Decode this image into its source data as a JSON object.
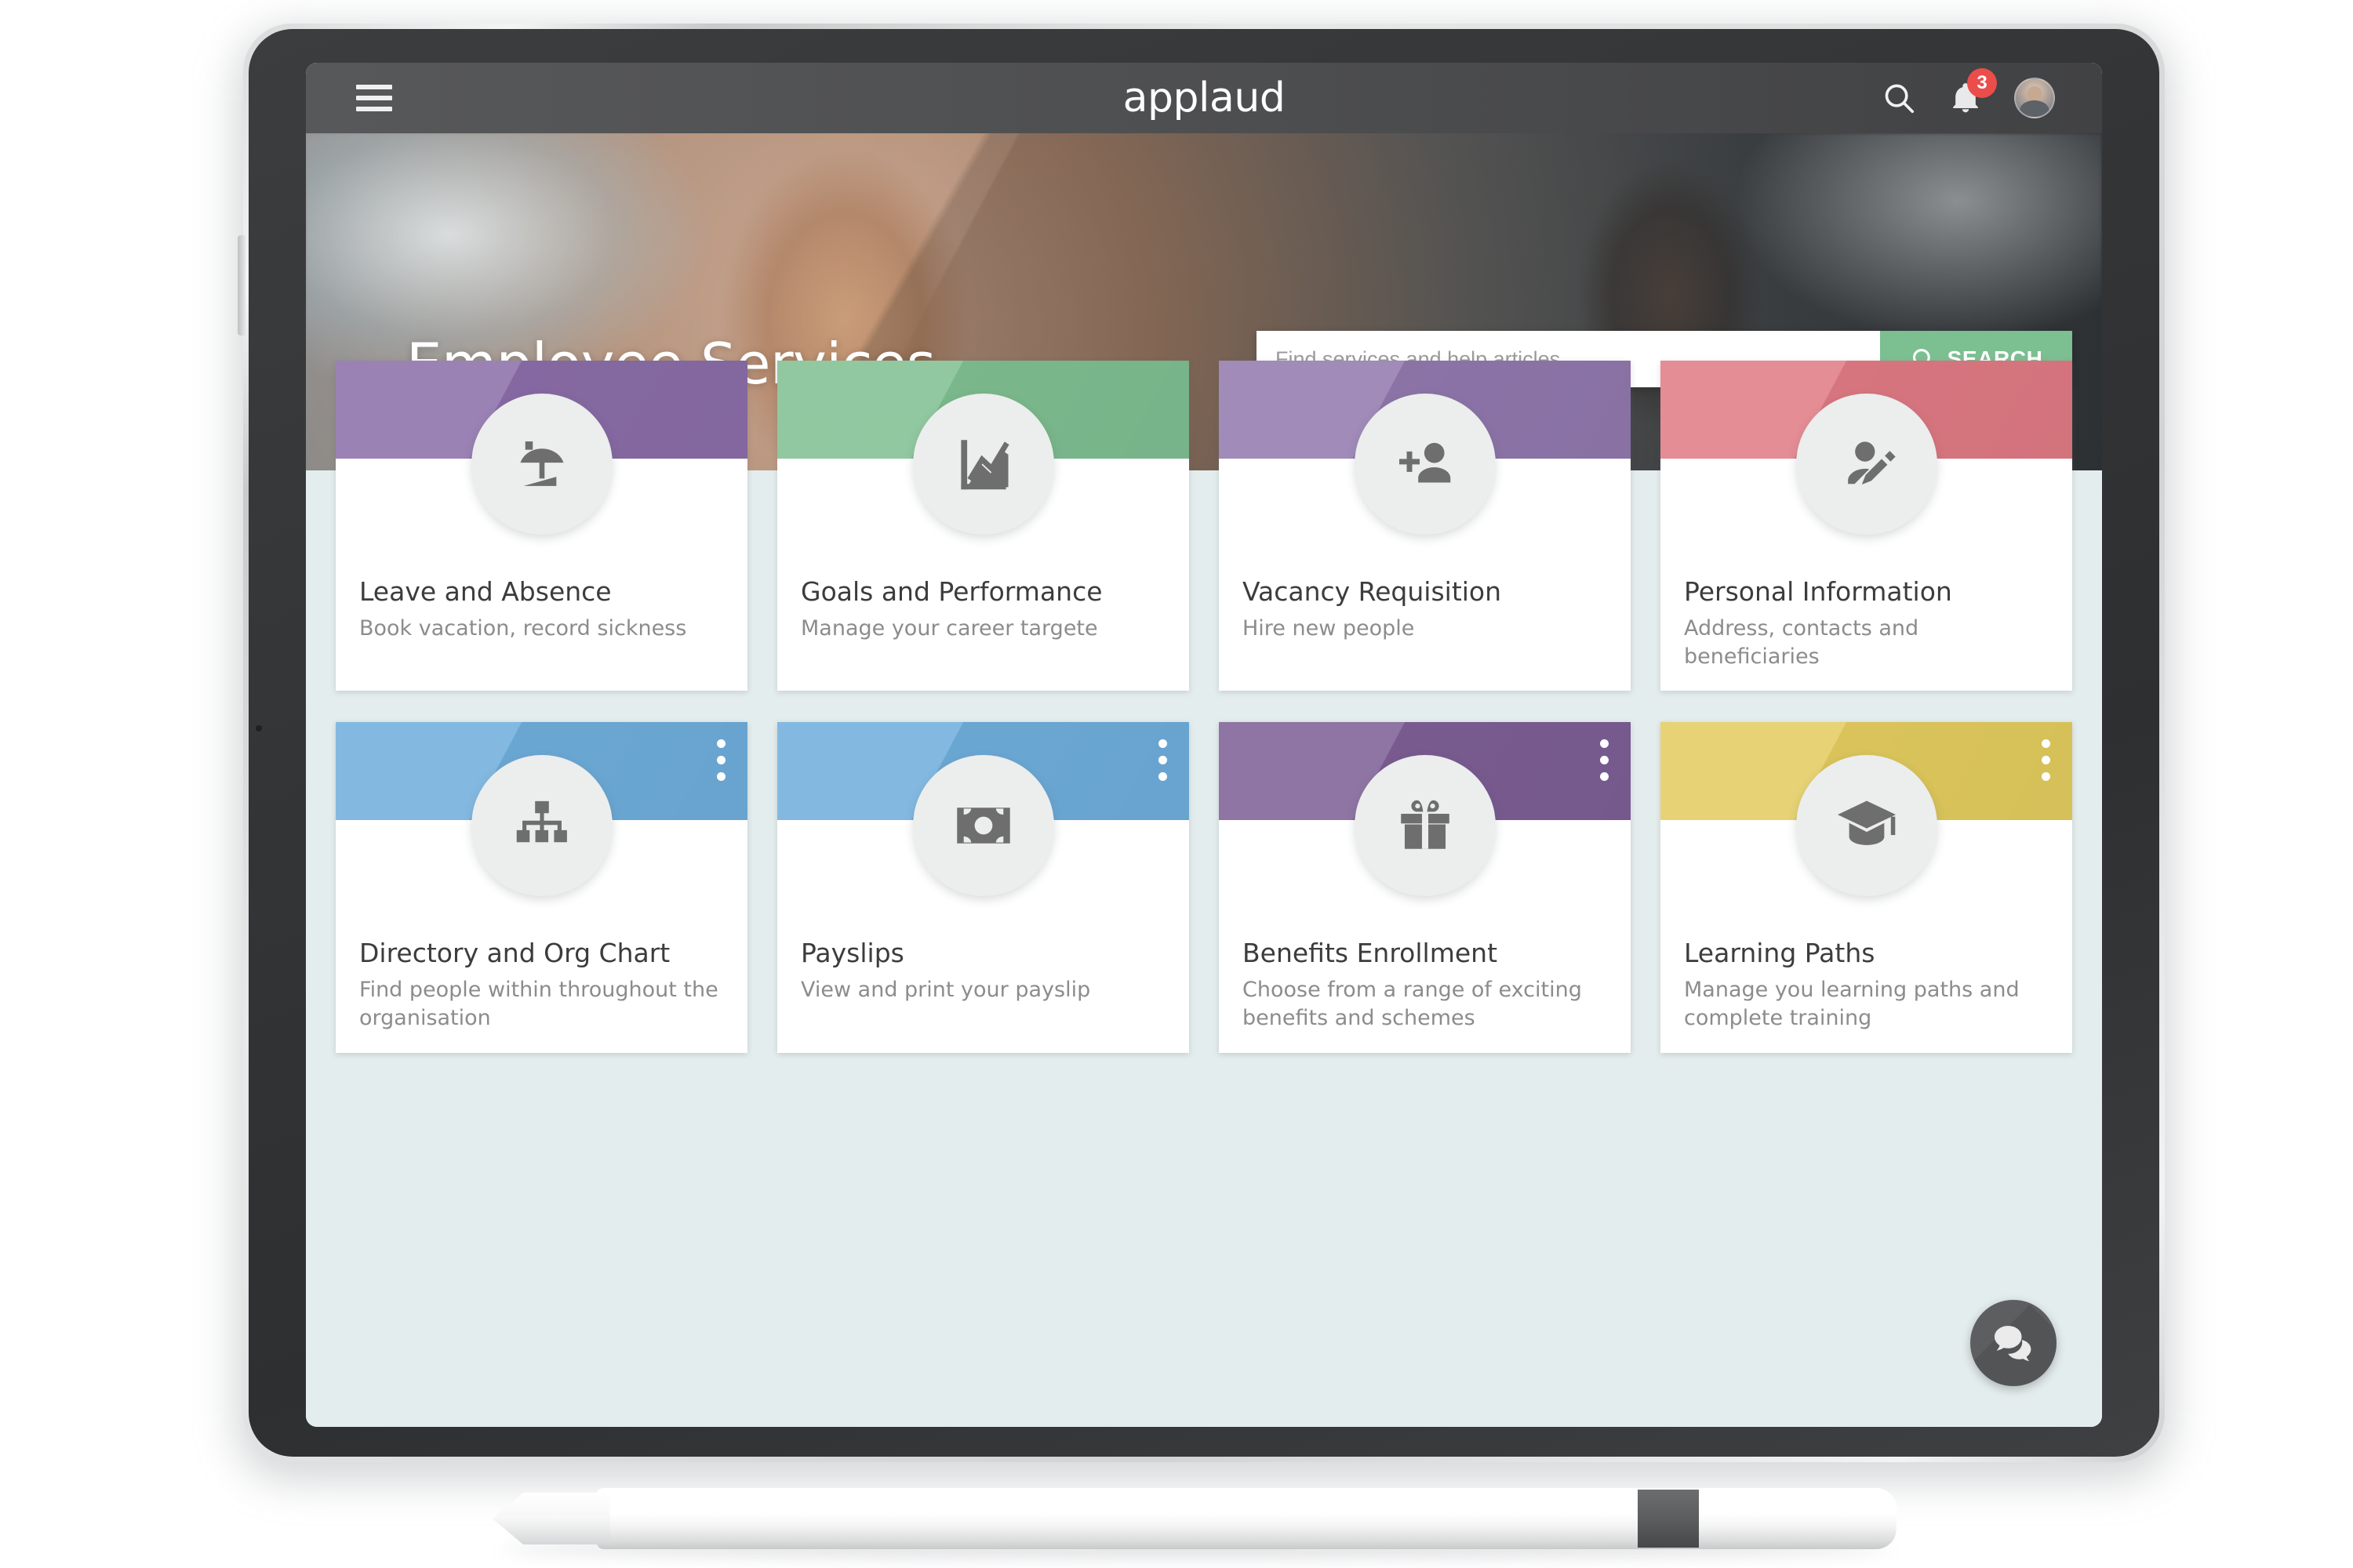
{
  "app": {
    "brand": "applaud",
    "menu_icon": "hamburger-menu-icon",
    "search_icon": "search-icon",
    "notification_icon": "bell-icon",
    "notification_count": "3",
    "avatar_icon": "user-avatar"
  },
  "hero": {
    "title": "Employee Services"
  },
  "search": {
    "placeholder": "Find services and help articles",
    "value": "",
    "button_label": "SEARCH",
    "button_color": "#7cbf91",
    "icon": "search-icon"
  },
  "cards": [
    {
      "title": "Leave and Absence",
      "subtitle": "Book vacation, record sickness",
      "color": "#8b6da8",
      "icon": "beach-umbrella-icon",
      "has_kebab": false
    },
    {
      "title": "Goals and Performance",
      "subtitle": "Manage your career targete",
      "color": "#7fbf91",
      "icon": "line-chart-icon",
      "has_kebab": false
    },
    {
      "title": "Vacancy Requisition",
      "subtitle": "Hire new people",
      "color": "#9178ae",
      "icon": "add-person-icon",
      "has_kebab": false
    },
    {
      "title": "Personal Information",
      "subtitle": "Address, contacts and beneficiaries",
      "color": "#e07a84",
      "icon": "edit-person-icon",
      "has_kebab": false
    },
    {
      "title": "Directory and Org Chart",
      "subtitle": "Find people within throughout the organisation",
      "color": "#6faedc",
      "icon": "org-chart-icon",
      "has_kebab": true
    },
    {
      "title": "Payslips",
      "subtitle": "View and print your payslip",
      "color": "#6faedc",
      "icon": "banknote-icon",
      "has_kebab": true
    },
    {
      "title": "Benefits Enrollment",
      "subtitle": "Choose from a range of exciting benefits and schemes",
      "color": "#7d5e95",
      "icon": "gift-icon",
      "has_kebab": true
    },
    {
      "title": "Learning Paths",
      "subtitle": "Manage you learning paths and complete training",
      "color": "#e3cc5e",
      "icon": "graduation-cap-icon",
      "has_kebab": true
    }
  ],
  "chat": {
    "icon": "chat-bubbles-icon",
    "color": "#5d5e60"
  }
}
